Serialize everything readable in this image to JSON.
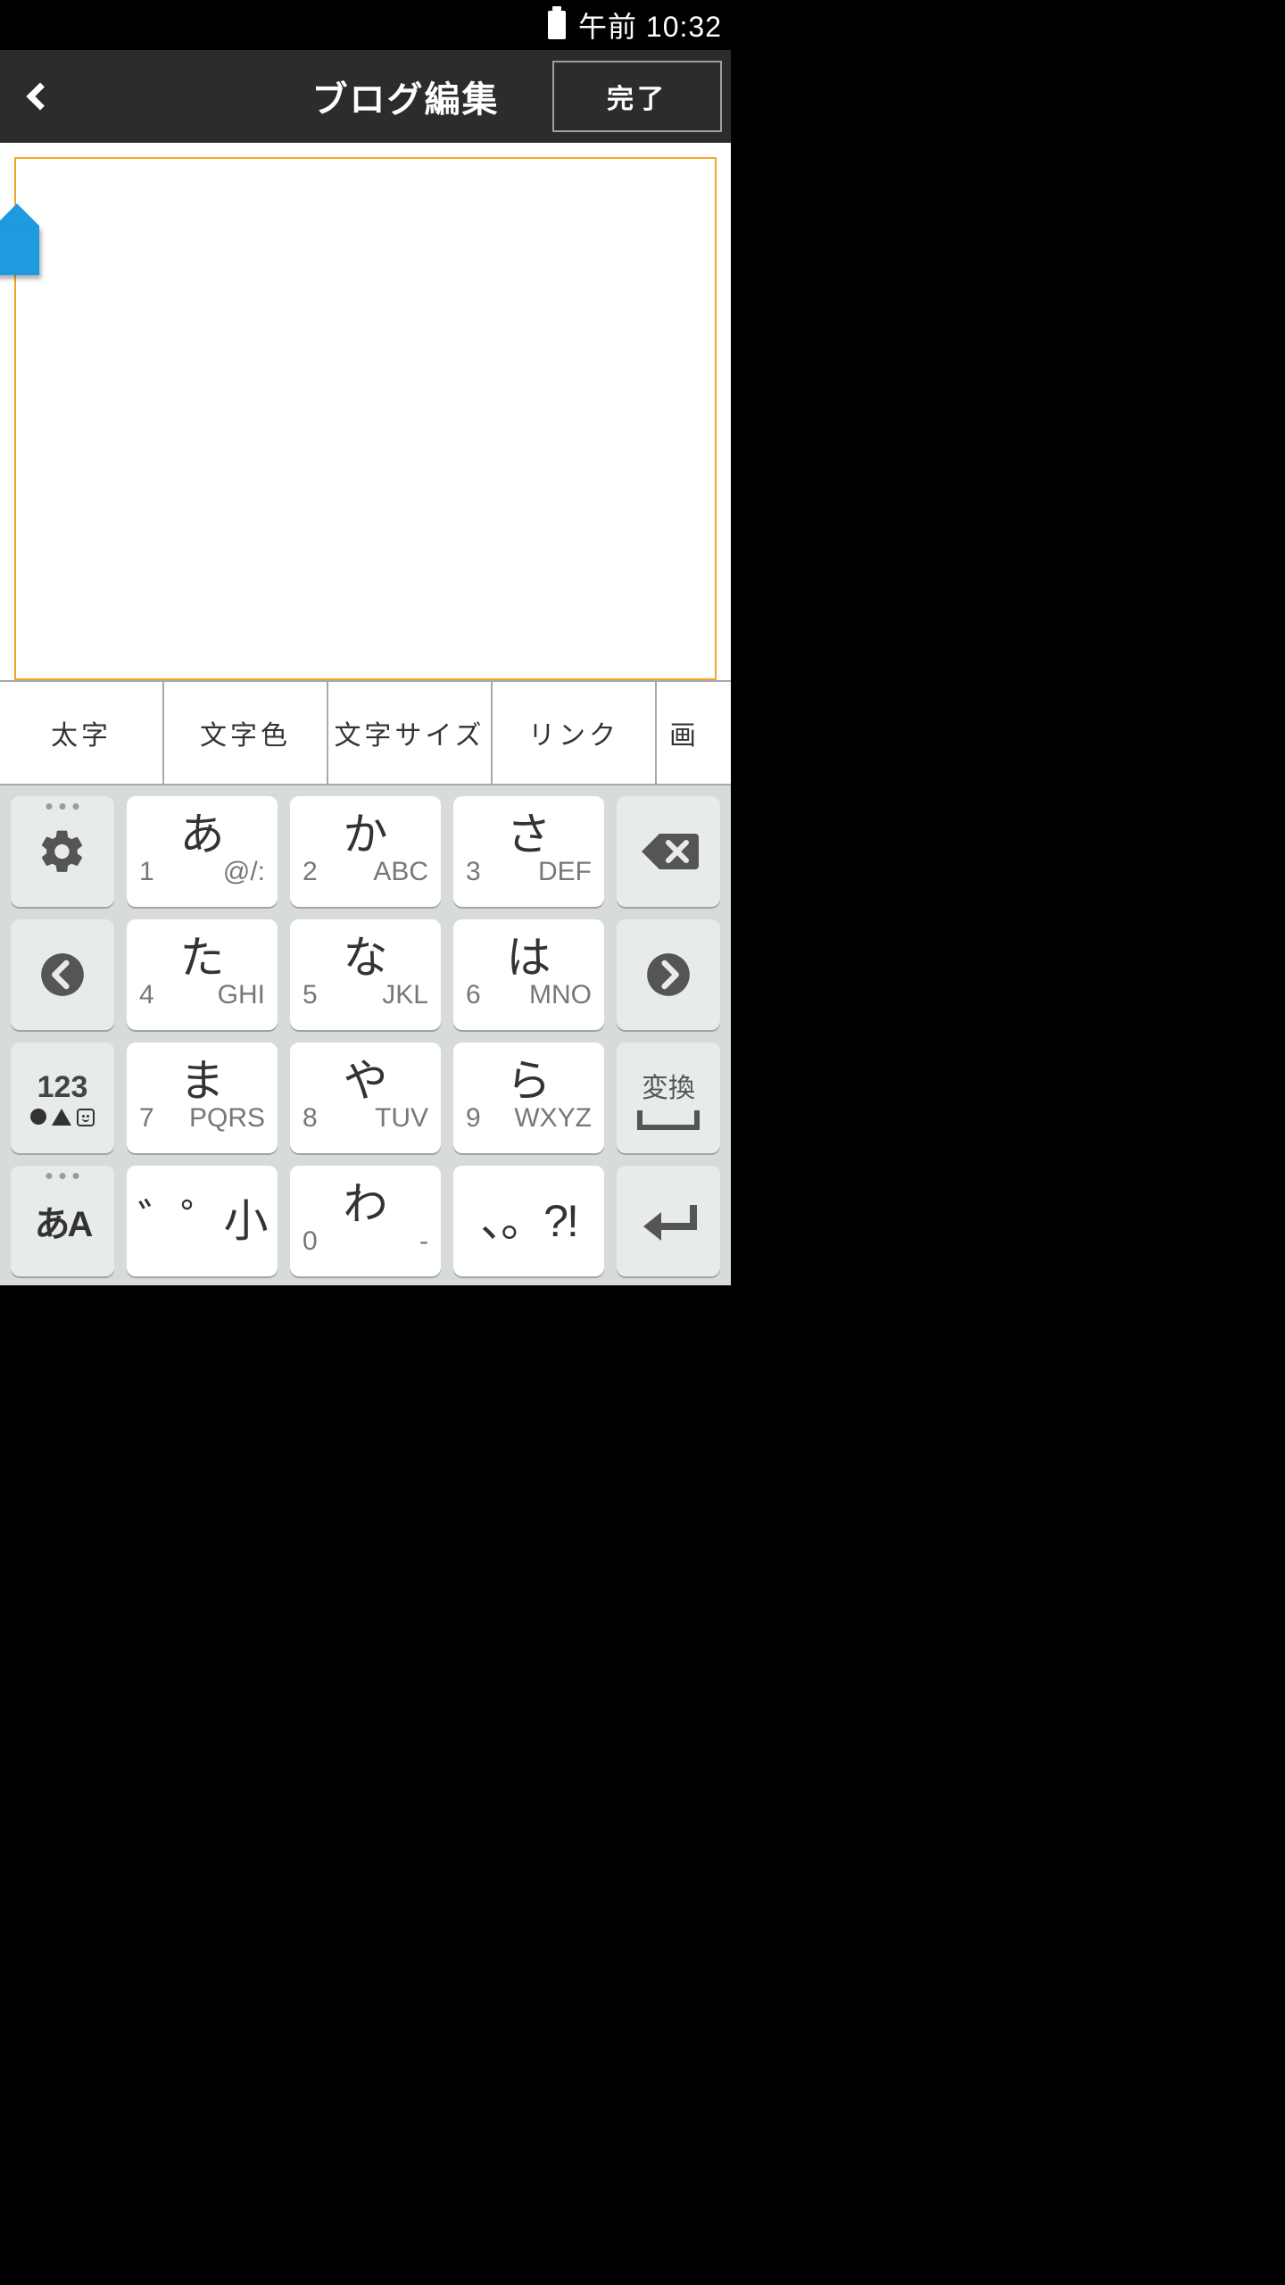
{
  "status": {
    "time_text": "午前 10:32"
  },
  "header": {
    "title": "ブログ編集",
    "done": "完了"
  },
  "editor": {
    "content": ""
  },
  "format_bar": {
    "items": [
      "太字",
      "文字色",
      "文字サイズ",
      "リンク"
    ],
    "partial": "画"
  },
  "keyboard": {
    "side": {
      "num_mode": "123",
      "lang": "あA",
      "henkan": "変換"
    },
    "rows": [
      [
        {
          "kana": "あ",
          "num": "1",
          "alpha": "@/:"
        },
        {
          "kana": "か",
          "num": "2",
          "alpha": "ABC"
        },
        {
          "kana": "さ",
          "num": "3",
          "alpha": "DEF"
        }
      ],
      [
        {
          "kana": "た",
          "num": "4",
          "alpha": "GHI"
        },
        {
          "kana": "な",
          "num": "5",
          "alpha": "JKL"
        },
        {
          "kana": "は",
          "num": "6",
          "alpha": "MNO"
        }
      ],
      [
        {
          "kana": "ま",
          "num": "7",
          "alpha": "PQRS"
        },
        {
          "kana": "や",
          "num": "8",
          "alpha": "TUV"
        },
        {
          "kana": "ら",
          "num": "9",
          "alpha": "WXYZ"
        }
      ],
      [
        {
          "kana": "゛゜小",
          "num": "",
          "alpha": ""
        },
        {
          "kana": "わ",
          "num": "0",
          "alpha": "-"
        },
        {
          "kana": "、。?!",
          "num": "",
          "alpha": ""
        }
      ]
    ]
  }
}
